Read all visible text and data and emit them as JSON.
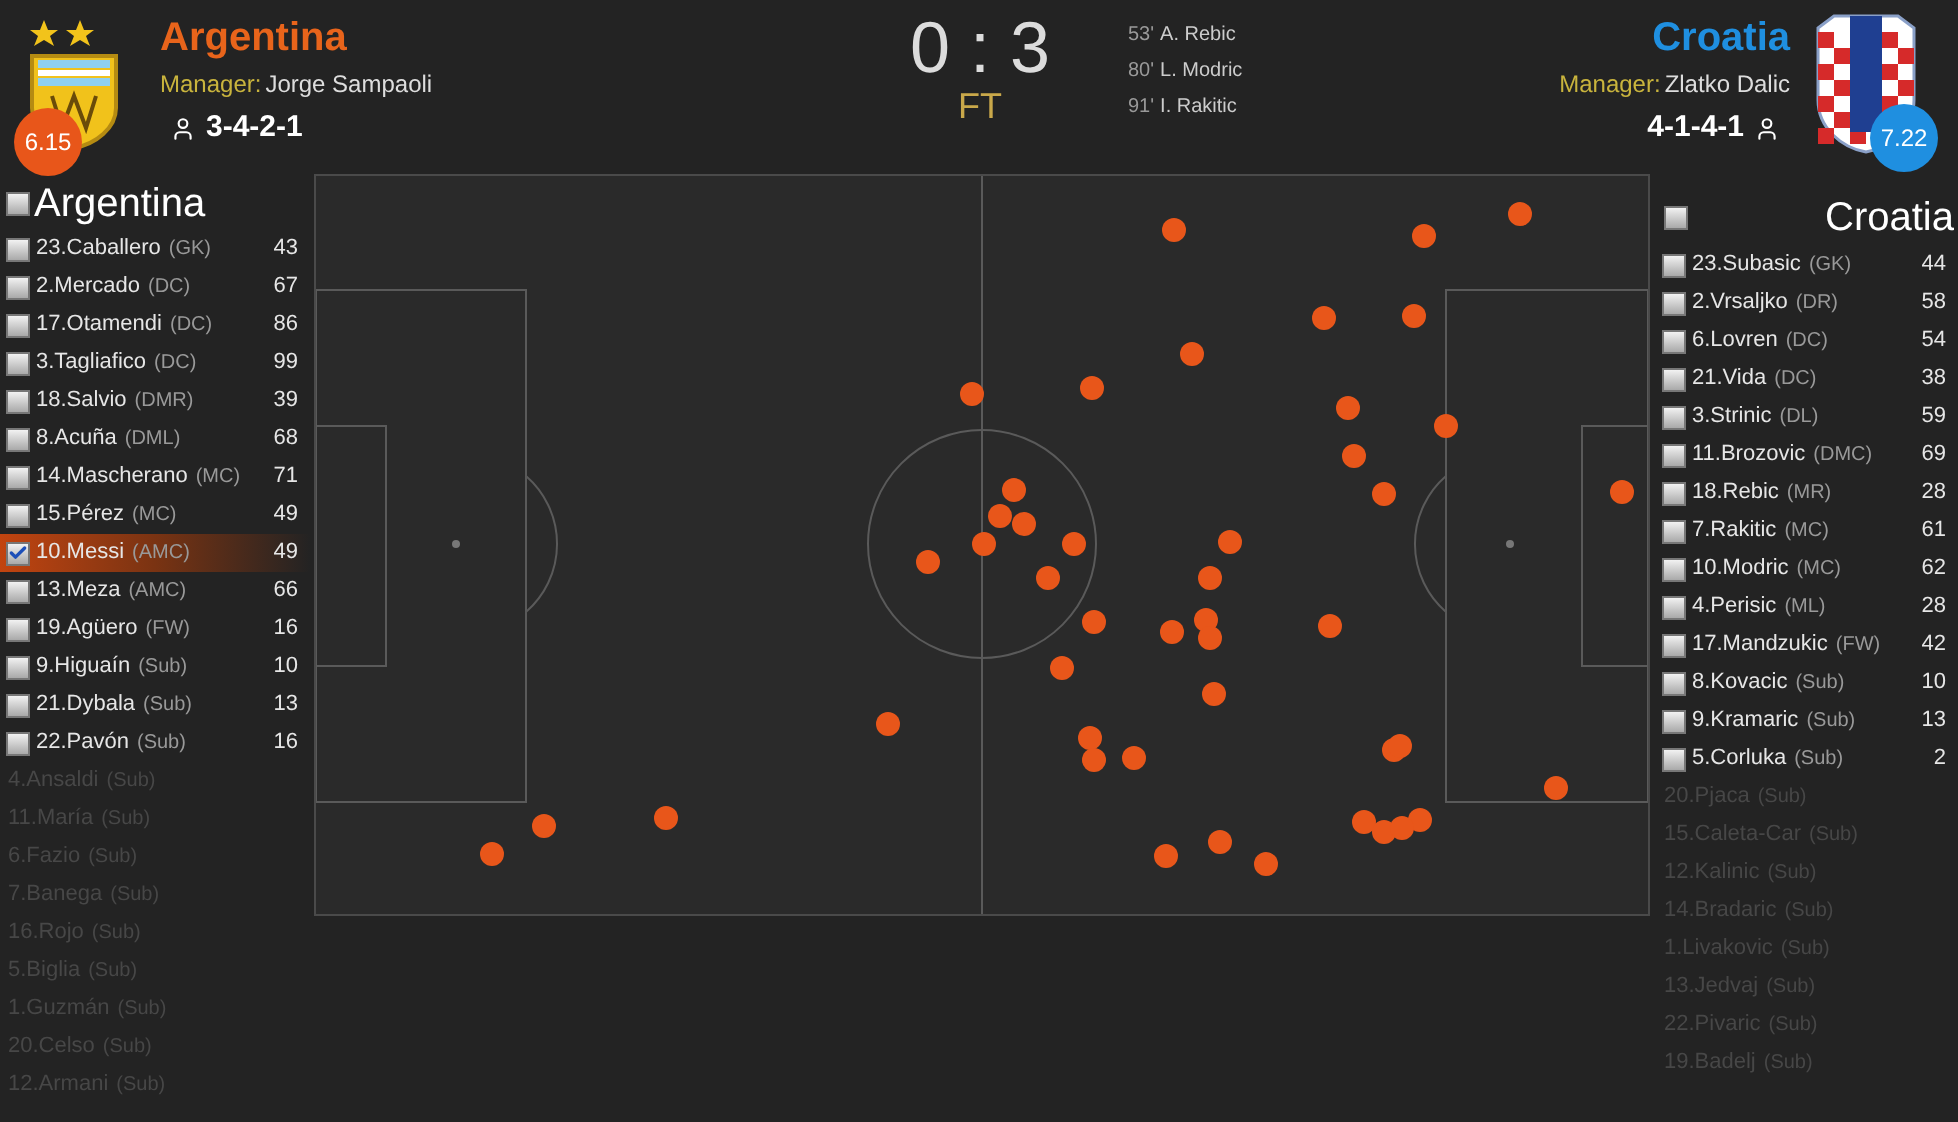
{
  "match": {
    "score": "0 : 3",
    "status": "FT",
    "goals": [
      {
        "minute": "53'",
        "scorer": "A. Rebic"
      },
      {
        "minute": "80'",
        "scorer": "L. Modric"
      },
      {
        "minute": "91'",
        "scorer": "I. Rakitic"
      }
    ]
  },
  "home_team": {
    "name": "Argentina",
    "manager_label": "Manager:",
    "manager": "Jorge Sampaoli",
    "formation": "3-4-2-1",
    "rating": "6.15",
    "list_title": "Argentina",
    "list_checked": false,
    "players": [
      {
        "kind": "played",
        "name": "23.Caballero",
        "position": "(GK)",
        "touches": "43",
        "checked": false
      },
      {
        "kind": "played",
        "name": "2.Mercado",
        "position": "(DC)",
        "touches": "67",
        "checked": false
      },
      {
        "kind": "played",
        "name": "17.Otamendi",
        "position": "(DC)",
        "touches": "86",
        "checked": false
      },
      {
        "kind": "played",
        "name": "3.Tagliafico",
        "position": "(DC)",
        "touches": "99",
        "checked": false
      },
      {
        "kind": "played",
        "name": "18.Salvio",
        "position": "(DMR)",
        "touches": "39",
        "checked": false
      },
      {
        "kind": "played",
        "name": "8.Acuña",
        "position": "(DML)",
        "touches": "68",
        "checked": false
      },
      {
        "kind": "played",
        "name": "14.Mascherano",
        "position": "(MC)",
        "touches": "71",
        "checked": false
      },
      {
        "kind": "played",
        "name": "15.Pérez",
        "position": "(MC)",
        "touches": "49",
        "checked": false
      },
      {
        "kind": "played",
        "name": "10.Messi",
        "position": "(AMC)",
        "touches": "49",
        "checked": true
      },
      {
        "kind": "played",
        "name": "13.Meza",
        "position": "(AMC)",
        "touches": "66",
        "checked": false
      },
      {
        "kind": "played",
        "name": "19.Agüero",
        "position": "(FW)",
        "touches": "16",
        "checked": false
      },
      {
        "kind": "played",
        "name": "9.Higuaín",
        "position": "(Sub)",
        "touches": "10",
        "checked": false
      },
      {
        "kind": "played",
        "name": "21.Dybala",
        "position": "(Sub)",
        "touches": "13",
        "checked": false
      },
      {
        "kind": "played",
        "name": "22.Pavón",
        "position": "(Sub)",
        "touches": "16",
        "checked": false
      },
      {
        "kind": "unused",
        "name": "4.Ansaldi",
        "position": "(Sub)"
      },
      {
        "kind": "unused",
        "name": "11.María",
        "position": "(Sub)"
      },
      {
        "kind": "unused",
        "name": "6.Fazio",
        "position": "(Sub)"
      },
      {
        "kind": "unused",
        "name": "7.Banega",
        "position": "(Sub)"
      },
      {
        "kind": "unused",
        "name": "16.Rojo",
        "position": "(Sub)"
      },
      {
        "kind": "unused",
        "name": "5.Biglia",
        "position": "(Sub)"
      },
      {
        "kind": "unused",
        "name": "1.Guzmán",
        "position": "(Sub)"
      },
      {
        "kind": "unused",
        "name": "20.Celso",
        "position": "(Sub)"
      },
      {
        "kind": "unused",
        "name": "12.Armani",
        "position": "(Sub)"
      }
    ]
  },
  "away_team": {
    "name": "Croatia",
    "manager_label": "Manager:",
    "manager": "Zlatko Dalic",
    "formation": "4-1-4-1",
    "rating": "7.22",
    "list_title": "Croatia",
    "list_checked": false,
    "players": [
      {
        "kind": "played",
        "name": "23.Subasic",
        "position": "(GK)",
        "touches": "44",
        "checked": false
      },
      {
        "kind": "played",
        "name": "2.Vrsaljko",
        "position": "(DR)",
        "touches": "58",
        "checked": false
      },
      {
        "kind": "played",
        "name": "6.Lovren",
        "position": "(DC)",
        "touches": "54",
        "checked": false
      },
      {
        "kind": "played",
        "name": "21.Vida",
        "position": "(DC)",
        "touches": "38",
        "checked": false
      },
      {
        "kind": "played",
        "name": "3.Strinic",
        "position": "(DL)",
        "touches": "59",
        "checked": false
      },
      {
        "kind": "played",
        "name": "11.Brozovic",
        "position": "(DMC)",
        "touches": "69",
        "checked": false
      },
      {
        "kind": "played",
        "name": "18.Rebic",
        "position": "(MR)",
        "touches": "28",
        "checked": false
      },
      {
        "kind": "played",
        "name": "7.Rakitic",
        "position": "(MC)",
        "touches": "61",
        "checked": false
      },
      {
        "kind": "played",
        "name": "10.Modric",
        "position": "(MC)",
        "touches": "62",
        "checked": false
      },
      {
        "kind": "played",
        "name": "4.Perisic",
        "position": "(ML)",
        "touches": "28",
        "checked": false
      },
      {
        "kind": "played",
        "name": "17.Mandzukic",
        "position": "(FW)",
        "touches": "42",
        "checked": false
      },
      {
        "kind": "played",
        "name": "8.Kovacic",
        "position": "(Sub)",
        "touches": "10",
        "checked": false
      },
      {
        "kind": "played",
        "name": "9.Kramaric",
        "position": "(Sub)",
        "touches": "13",
        "checked": false
      },
      {
        "kind": "played",
        "name": "5.Corluka",
        "position": "(Sub)",
        "touches": "2",
        "checked": false
      },
      {
        "kind": "unused",
        "name": "20.Pjaca",
        "position": "(Sub)"
      },
      {
        "kind": "unused",
        "name": "15.Caleta-Car",
        "position": "(Sub)"
      },
      {
        "kind": "unused",
        "name": "12.Kalinic",
        "position": "(Sub)"
      },
      {
        "kind": "unused",
        "name": "14.Bradaric",
        "position": "(Sub)"
      },
      {
        "kind": "unused",
        "name": "1.Livakovic",
        "position": "(Sub)"
      },
      {
        "kind": "unused",
        "name": "13.Jedvaj",
        "position": "(Sub)"
      },
      {
        "kind": "unused",
        "name": "22.Pivaric",
        "position": "(Sub)"
      },
      {
        "kind": "unused",
        "name": "19.Badelj",
        "position": "(Sub)"
      }
    ]
  }
}
